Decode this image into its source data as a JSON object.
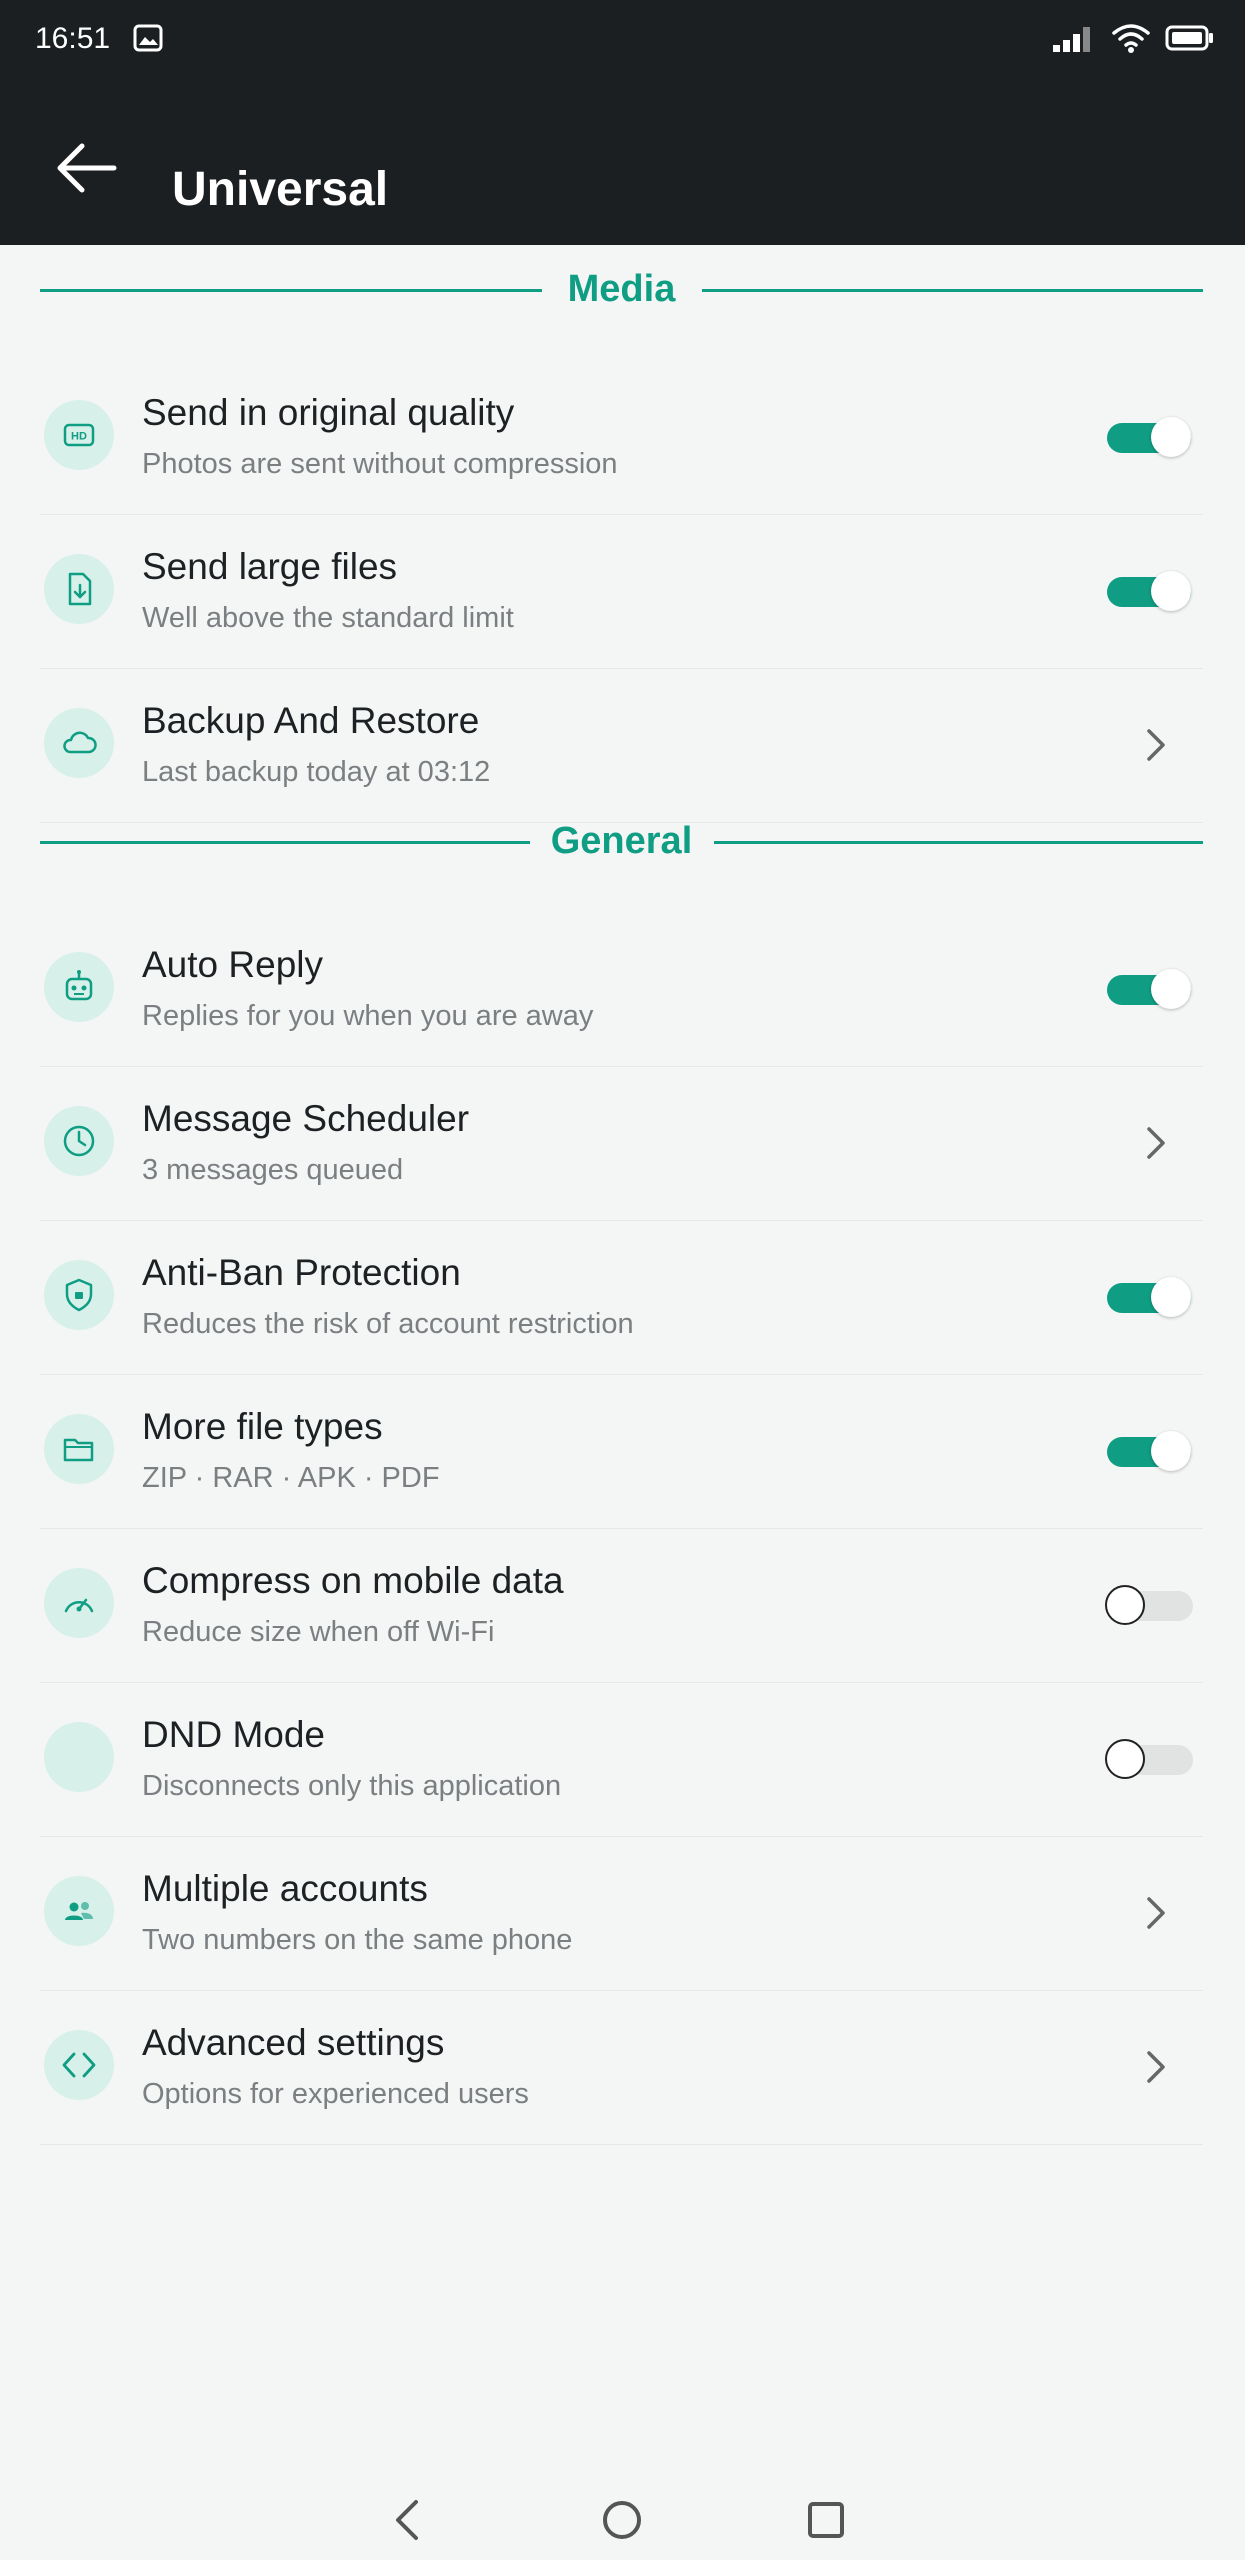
{
  "status_bar": {
    "time": "16:51",
    "icons": [
      "image-icon",
      "signal-icon",
      "wifi-icon",
      "battery-icon"
    ]
  },
  "app_bar": {
    "title": "Universal",
    "back_icon": "arrow-left-icon"
  },
  "sections": {
    "media": {
      "label": "Media",
      "items": [
        {
          "title": "Send in original quality",
          "subtitle": "Photos are sent without compression",
          "icon": "hd-icon",
          "control": "toggle",
          "on": true
        },
        {
          "title": "Send large files",
          "subtitle": "Well above the standard limit",
          "icon": "file-download-icon",
          "control": "toggle",
          "on": true
        },
        {
          "title": "Backup And Restore",
          "subtitle": "Last backup today at 03:12",
          "icon": "cloud-icon",
          "control": "chevron"
        }
      ]
    },
    "general": {
      "label": "General",
      "items": [
        {
          "title": "Auto Reply",
          "subtitle": "Replies for you when you are away",
          "icon": "robot-icon",
          "control": "toggle",
          "on": true
        },
        {
          "title": "Message Scheduler",
          "subtitle": "3 messages queued",
          "icon": "clock-icon",
          "control": "chevron"
        },
        {
          "title": "Anti-Ban Protection",
          "subtitle": "Reduces the risk of account restriction",
          "icon": "shield-icon",
          "control": "toggle",
          "on": true
        },
        {
          "title": "More file types",
          "subtitle": "ZIP · RAR · APK · PDF",
          "icon": "folder-icon",
          "control": "toggle",
          "on": true
        },
        {
          "title": "Compress on mobile data",
          "subtitle": "Reduce size when off Wi-Fi",
          "icon": "speedometer-icon",
          "control": "toggle",
          "on": false
        },
        {
          "title": "DND Mode",
          "subtitle": "Disconnects only this application",
          "icon": "moon-icon",
          "control": "toggle",
          "on": false
        },
        {
          "title": "Multiple accounts",
          "subtitle": "Two numbers on the same phone",
          "icon": "people-icon",
          "control": "chevron"
        },
        {
          "title": "Advanced settings",
          "subtitle": "Options for experienced users",
          "icon": "code-icon",
          "control": "chevron"
        }
      ]
    }
  },
  "colors": {
    "accent": "#0f9d83",
    "bar_background": "#1c1f21",
    "page_background": "#f4f6f5",
    "icon_background": "#d7f0e9",
    "toggle_off": "#e1e3e2"
  },
  "nav_bar": {
    "buttons": [
      "back-icon",
      "home-icon",
      "recents-icon"
    ]
  }
}
